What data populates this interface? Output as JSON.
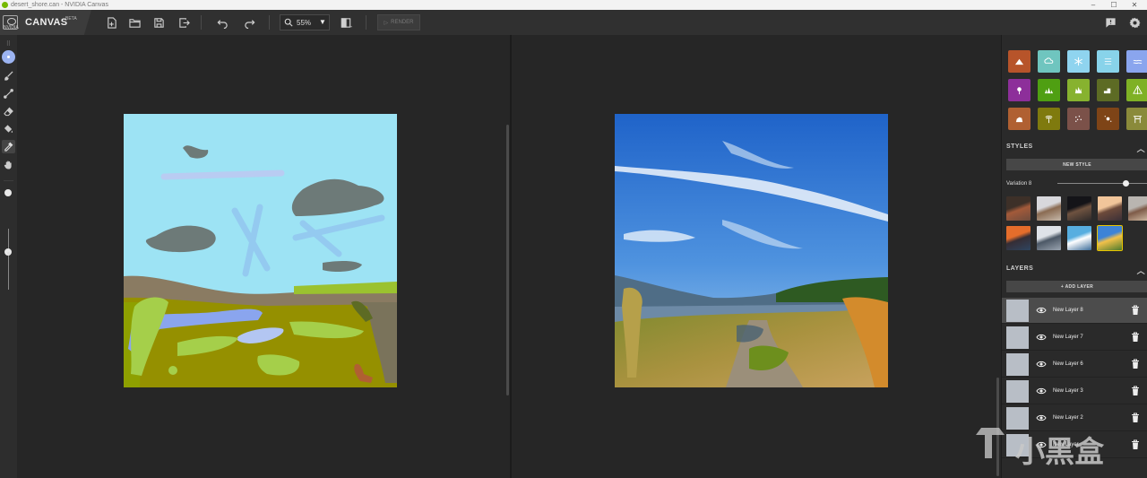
{
  "window": {
    "title": "desert_shore.can - NVIDIA Canvas",
    "min": "–",
    "max": "☐",
    "close": "✕"
  },
  "toolbar": {
    "brand_logo_text": "NVIDIA",
    "app_name": "CANVAS",
    "beta": "BETA",
    "zoom": "55%",
    "zoom_arrow": "▼",
    "render_label": "RENDER",
    "icons": [
      "new-file-icon",
      "open-folder-icon",
      "save-icon",
      "export-icon",
      "undo-icon",
      "redo-icon",
      "zoom-icon",
      "compare-icon",
      "feedback-icon",
      "settings-icon"
    ]
  },
  "tools": [
    "brush-color-icon",
    "brush-icon",
    "line-icon",
    "eraser-icon",
    "fill-icon",
    "eyedropper-icon",
    "pan-hand-icon"
  ],
  "brush_size_level": 0.62,
  "materials": [
    {
      "color": "#b7542a",
      "icon": "mountain-icon"
    },
    {
      "color": "#6fc5bf",
      "icon": "cloud-icon"
    },
    {
      "color": "#8fd4ef",
      "icon": "snow-icon"
    },
    {
      "color": "#88d3ea",
      "icon": "sky-icon"
    },
    {
      "color": "#8aa5ee",
      "icon": "water-icon"
    },
    {
      "color": "#8d2f9a",
      "icon": "flower-icon"
    },
    {
      "color": "#4f9f12",
      "icon": "grass-icon"
    },
    {
      "color": "#87b22f",
      "icon": "bush-icon"
    },
    {
      "color": "#5d6b24",
      "icon": "hill-icon"
    },
    {
      "color": "#7fb125",
      "icon": "tree-icon"
    },
    {
      "color": "#b06032",
      "icon": "rock-icon"
    },
    {
      "color": "#7f7a0e",
      "icon": "palm-icon"
    },
    {
      "color": "#7b5149",
      "icon": "gravel-icon"
    },
    {
      "color": "#7e4417",
      "icon": "dirt-icon"
    },
    {
      "color": "#8a8a3a",
      "icon": "structure-icon"
    }
  ],
  "styles": {
    "header": "STYLES",
    "new_style": "NEW STYLE",
    "variation_label": "Variation 8",
    "variation_level": 0.76,
    "thumbs": [
      {
        "colors": [
          "#3d3028",
          "#a35a3a",
          "#6e4c3d"
        ]
      },
      {
        "colors": [
          "#d8d8dc",
          "#8a6b52",
          "#c6b8aa"
        ]
      },
      {
        "colors": [
          "#141418",
          "#6f5340",
          "#2e2a2a"
        ]
      },
      {
        "colors": [
          "#f1c59a",
          "#6d4a3a",
          "#3b3038"
        ]
      },
      {
        "colors": [
          "#b9b5b0",
          "#7e5b48",
          "#d8c3ab"
        ]
      },
      {
        "colors": [
          "#e56d2b",
          "#352d35",
          "#2f4560"
        ]
      },
      {
        "colors": [
          "#dfe3e8",
          "#4c5866",
          "#9aa4b0"
        ]
      },
      {
        "colors": [
          "#57aee0",
          "#ffffff",
          "#3b6c9a"
        ]
      },
      {
        "colors": [
          "#3d83d6",
          "#f2c14a",
          "#4d7a2b"
        ]
      }
    ],
    "selected_index": 8
  },
  "layers": {
    "header": "LAYERS",
    "add_label": "+ ADD LAYER",
    "items": [
      {
        "name": "New Layer 8",
        "active": true
      },
      {
        "name": "New Layer 7",
        "active": false
      },
      {
        "name": "New Layer 6",
        "active": false
      },
      {
        "name": "New Layer 3",
        "active": false
      },
      {
        "name": "New Layer 2",
        "active": false
      },
      {
        "name": "New Layer",
        "active": false
      }
    ]
  },
  "watermark": "小黑盒"
}
